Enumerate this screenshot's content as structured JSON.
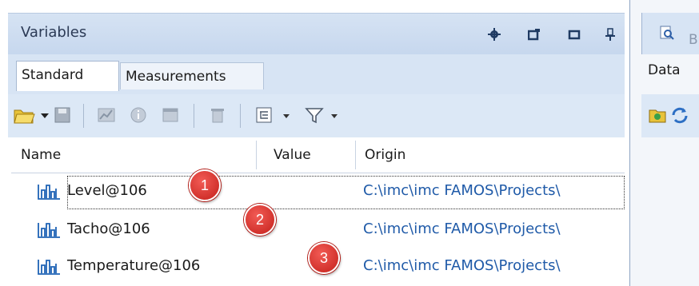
{
  "panel": {
    "title": "Variables",
    "tabs": [
      {
        "label": "Standard",
        "active": true
      },
      {
        "label": "Measurements",
        "active": false
      }
    ],
    "toolbar_icons": [
      "folder-open-icon",
      "dropdown-arrow-icon",
      "save-icon",
      "chart-icon",
      "info-icon",
      "table-icon",
      "delete-icon",
      "tree-view-icon",
      "dropdown-arrow-icon",
      "filter-icon",
      "dropdown-arrow-icon"
    ],
    "columns": [
      "Name",
      "Value",
      "Origin"
    ],
    "rows": [
      {
        "name": "Level@106",
        "value": "",
        "origin": "C:\\imc\\imc FAMOS\\Projects\\",
        "icon": "waveform-icon"
      },
      {
        "name": "Tacho@106",
        "value": "",
        "origin": "C:\\imc\\imc FAMOS\\Projects\\",
        "icon": "waveform-icon"
      },
      {
        "name": "Temperature@106",
        "value": "",
        "origin": "C:\\imc\\imc FAMOS\\Projects\\",
        "icon": "waveform-icon"
      }
    ],
    "markers": [
      "1",
      "2",
      "3"
    ]
  },
  "side_panel": {
    "tab_partial": "B",
    "label": "Data"
  },
  "colors": {
    "title_bar": "#c6d7ee",
    "origin_text": "#1f5aa8",
    "marker": "#d7302a"
  }
}
